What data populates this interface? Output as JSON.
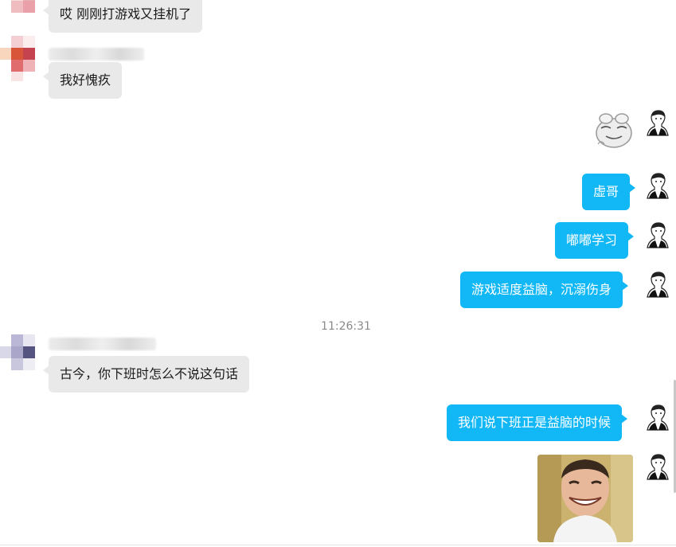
{
  "timestamp": "11:26:31",
  "messages_incoming": [
    {
      "text": "哎 刚刚打游戏又挂机了"
    },
    {
      "text": "我好愧疚"
    },
    {
      "text": "古今，你下班时怎么不说这句话"
    }
  ],
  "messages_outgoing": [
    {
      "text": "虚哥"
    },
    {
      "text": "嘟嘟学习"
    },
    {
      "text": "游戏适度益脑，沉溺伤身"
    },
    {
      "text": "我们说下班正是益脑的时候"
    }
  ],
  "colors": {
    "outgoing_bubble": "#12b7f5",
    "incoming_bubble": "#e9e9e9"
  },
  "icons": {
    "my_avatar": "sketch-portrait-avatar-icon",
    "sticker_frog": "frog-sticker-icon",
    "sticker_laughing_man": "laughing-man-sticker-icon"
  }
}
